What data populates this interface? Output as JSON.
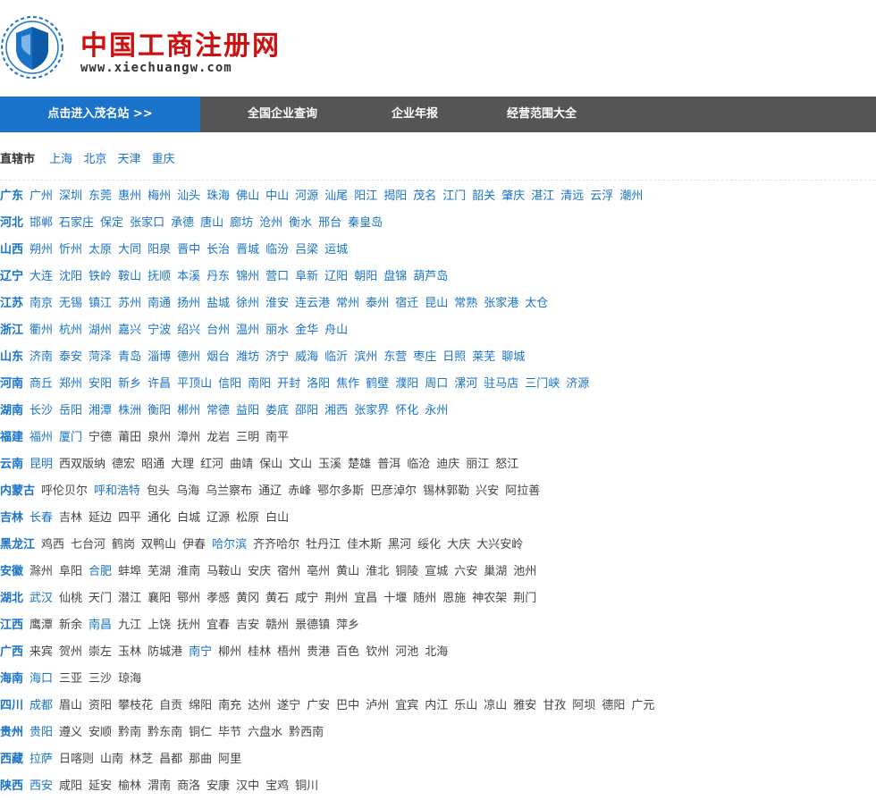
{
  "header": {
    "title": "中国工商注册网",
    "subtitle": "www.xiechuangw.com",
    "logo_icon": "shield-wreath-icon"
  },
  "nav": {
    "items": [
      "点击进入茂名站 >>",
      "全国企业查询",
      "企业年报",
      "经营范围大全"
    ]
  },
  "direct_cities": {
    "label": "直辖市",
    "cities": [
      "上海",
      "北京",
      "天津",
      "重庆"
    ]
  },
  "provinces": [
    {
      "name": "广东",
      "cities": [
        "广州",
        "深圳",
        "东莞",
        "惠州",
        "梅州",
        "汕头",
        "珠海",
        "佛山",
        "中山",
        "河源",
        "汕尾",
        "阳江",
        "揭阳",
        "茂名",
        "江门",
        "韶关",
        "肇庆",
        "湛江",
        "清远",
        "云浮",
        "潮州"
      ]
    },
    {
      "name": "河北",
      "cities": [
        "邯郸",
        "石家庄",
        "保定",
        "张家口",
        "承德",
        "唐山",
        "廊坊",
        "沧州",
        "衡水",
        "邢台",
        "秦皇岛"
      ]
    },
    {
      "name": "山西",
      "cities": [
        "朔州",
        "忻州",
        "太原",
        "大同",
        "阳泉",
        "晋中",
        "长治",
        "晋城",
        "临汾",
        "吕梁",
        "运城"
      ]
    },
    {
      "name": "辽宁",
      "cities": [
        "大连",
        "沈阳",
        "铁岭",
        "鞍山",
        "抚顺",
        "本溪",
        "丹东",
        "锦州",
        "营口",
        "阜新",
        "辽阳",
        "朝阳",
        "盘锦",
        "葫芦岛"
      ]
    },
    {
      "name": "江苏",
      "cities": [
        "南京",
        "无锡",
        "镇江",
        "苏州",
        "南通",
        "扬州",
        "盐城",
        "徐州",
        "淮安",
        "连云港",
        "常州",
        "泰州",
        "宿迁",
        "昆山",
        "常熟",
        "张家港",
        "太仓"
      ]
    },
    {
      "name": "浙江",
      "cities": [
        "衢州",
        "杭州",
        "湖州",
        "嘉兴",
        "宁波",
        "绍兴",
        "台州",
        "温州",
        "丽水",
        "金华",
        "舟山"
      ]
    },
    {
      "name": "山东",
      "cities": [
        "济南",
        "泰安",
        "菏泽",
        "青岛",
        "淄博",
        "德州",
        "烟台",
        "潍坊",
        "济宁",
        "威海",
        "临沂",
        "滨州",
        "东营",
        "枣庄",
        "日照",
        "莱芜",
        "聊城"
      ]
    },
    {
      "name": "河南",
      "cities": [
        "商丘",
        "郑州",
        "安阳",
        "新乡",
        "许昌",
        "平顶山",
        "信阳",
        "南阳",
        "开封",
        "洛阳",
        "焦作",
        "鹤壁",
        "濮阳",
        "周口",
        "漯河",
        "驻马店",
        "三门峡",
        "济源"
      ]
    },
    {
      "name": "湖南",
      "cities": [
        "长沙",
        "岳阳",
        "湘潭",
        "株洲",
        "衡阳",
        "郴州",
        "常德",
        "益阳",
        "娄底",
        "邵阳",
        "湘西",
        "张家界",
        "怀化",
        "永州"
      ]
    },
    {
      "name": "福建",
      "cities": [
        "福州",
        "厦门",
        "宁德",
        "莆田",
        "泉州",
        "漳州",
        "龙岩",
        "三明",
        "南平"
      ]
    },
    {
      "name": "云南",
      "cities": [
        "昆明",
        "西双版纳",
        "德宏",
        "昭通",
        "大理",
        "红河",
        "曲靖",
        "保山",
        "文山",
        "玉溪",
        "楚雄",
        "普洱",
        "临沧",
        "迪庆",
        "丽江",
        "怒江"
      ]
    },
    {
      "name": "内蒙古",
      "cities": [
        "呼伦贝尔",
        "呼和浩特",
        "包头",
        "乌海",
        "乌兰察布",
        "通辽",
        "赤峰",
        "鄂尔多斯",
        "巴彦淖尔",
        "锡林郭勒",
        "兴安",
        "阿拉善"
      ]
    },
    {
      "name": "吉林",
      "cities": [
        "长春",
        "吉林",
        "延边",
        "四平",
        "通化",
        "白城",
        "辽源",
        "松原",
        "白山"
      ]
    },
    {
      "name": "黑龙江",
      "cities": [
        "鸡西",
        "七台河",
        "鹤岗",
        "双鸭山",
        "伊春",
        "哈尔滨",
        "齐齐哈尔",
        "牡丹江",
        "佳木斯",
        "黑河",
        "绥化",
        "大庆",
        "大兴安岭"
      ]
    },
    {
      "name": "安徽",
      "cities": [
        "滁州",
        "阜阳",
        "合肥",
        "蚌埠",
        "芜湖",
        "淮南",
        "马鞍山",
        "安庆",
        "宿州",
        "亳州",
        "黄山",
        "淮北",
        "铜陵",
        "宣城",
        "六安",
        "巢湖",
        "池州"
      ]
    },
    {
      "name": "湖北",
      "cities": [
        "武汉",
        "仙桃",
        "天门",
        "潜江",
        "襄阳",
        "鄂州",
        "孝感",
        "黄冈",
        "黄石",
        "咸宁",
        "荆州",
        "宜昌",
        "十堰",
        "随州",
        "恩施",
        "神农架",
        "荆门"
      ]
    },
    {
      "name": "江西",
      "cities": [
        "鹰潭",
        "新余",
        "南昌",
        "九江",
        "上饶",
        "抚州",
        "宜春",
        "吉安",
        "赣州",
        "景德镇",
        "萍乡"
      ]
    },
    {
      "name": "广西",
      "cities": [
        "来宾",
        "贺州",
        "崇左",
        "玉林",
        "防城港",
        "南宁",
        "柳州",
        "桂林",
        "梧州",
        "贵港",
        "百色",
        "钦州",
        "河池",
        "北海"
      ]
    },
    {
      "name": "海南",
      "cities": [
        "海口",
        "三亚",
        "三沙",
        "琼海"
      ]
    },
    {
      "name": "四川",
      "cities": [
        "成都",
        "眉山",
        "资阳",
        "攀枝花",
        "自贡",
        "绵阳",
        "南充",
        "达州",
        "遂宁",
        "广安",
        "巴中",
        "泸州",
        "宜宾",
        "内江",
        "乐山",
        "凉山",
        "雅安",
        "甘孜",
        "阿坝",
        "德阳",
        "广元"
      ]
    },
    {
      "name": "贵州",
      "cities": [
        "贵阳",
        "遵义",
        "安顺",
        "黔南",
        "黔东南",
        "铜仁",
        "毕节",
        "六盘水",
        "黔西南"
      ]
    },
    {
      "name": "西藏",
      "cities": [
        "拉萨",
        "日喀则",
        "山南",
        "林芝",
        "昌都",
        "那曲",
        "阿里"
      ]
    },
    {
      "name": "陕西",
      "cities": [
        "西安",
        "咸阳",
        "延安",
        "榆林",
        "渭南",
        "商洛",
        "安康",
        "汉中",
        "宝鸡",
        "铜川"
      ]
    }
  ],
  "highlighted_cities": [
    "广州",
    "深圳",
    "东莞",
    "惠州",
    "梅州",
    "汕头",
    "珠海",
    "佛山",
    "中山",
    "河源",
    "汕尾",
    "阳江",
    "揭阳",
    "茂名",
    "江门",
    "韶关",
    "肇庆",
    "湛江",
    "清远",
    "云浮",
    "潮州",
    "邯郸",
    "石家庄",
    "保定",
    "张家口",
    "承德",
    "唐山",
    "廊坊",
    "沧州",
    "衡水",
    "邢台",
    "秦皇岛",
    "朔州",
    "忻州",
    "太原",
    "大同",
    "阳泉",
    "晋中",
    "长治",
    "晋城",
    "临汾",
    "吕梁",
    "运城",
    "大连",
    "沈阳",
    "铁岭",
    "鞍山",
    "抚顺",
    "本溪",
    "丹东",
    "锦州",
    "营口",
    "阜新",
    "辽阳",
    "朝阳",
    "盘锦",
    "葫芦岛",
    "南京",
    "无锡",
    "镇江",
    "苏州",
    "南通",
    "扬州",
    "盐城",
    "徐州",
    "淮安",
    "连云港",
    "常州",
    "泰州",
    "宿迁",
    "昆山",
    "常熟",
    "张家港",
    "太仓",
    "衢州",
    "杭州",
    "湖州",
    "嘉兴",
    "宁波",
    "绍兴",
    "台州",
    "温州",
    "丽水",
    "金华",
    "舟山",
    "济南",
    "泰安",
    "菏泽",
    "青岛",
    "淄博",
    "德州",
    "烟台",
    "潍坊",
    "济宁",
    "威海",
    "临沂",
    "滨州",
    "东营",
    "枣庄",
    "日照",
    "莱芜",
    "聊城",
    "商丘",
    "郑州",
    "安阳",
    "新乡",
    "许昌",
    "平顶山",
    "信阳",
    "南阳",
    "开封",
    "洛阳",
    "焦作",
    "鹤壁",
    "濮阳",
    "周口",
    "漯河",
    "驻马店",
    "三门峡",
    "济源",
    "长沙",
    "岳阳",
    "湘潭",
    "株洲",
    "衡阳",
    "郴州",
    "常德",
    "益阳",
    "娄底",
    "邵阳",
    "湘西",
    "张家界",
    "怀化",
    "永州",
    "福州",
    "厦门",
    "昆明",
    "呼和浩特",
    "长春",
    "哈尔滨",
    "合肥",
    "武汉",
    "南昌",
    "南宁",
    "海口",
    "成都",
    "贵阳",
    "拉萨",
    "西安"
  ],
  "colors": {
    "link": "#1a73c8",
    "nav_bg": "#555555",
    "nav_active": "#1a73c8",
    "title_red": "#cc1111"
  }
}
